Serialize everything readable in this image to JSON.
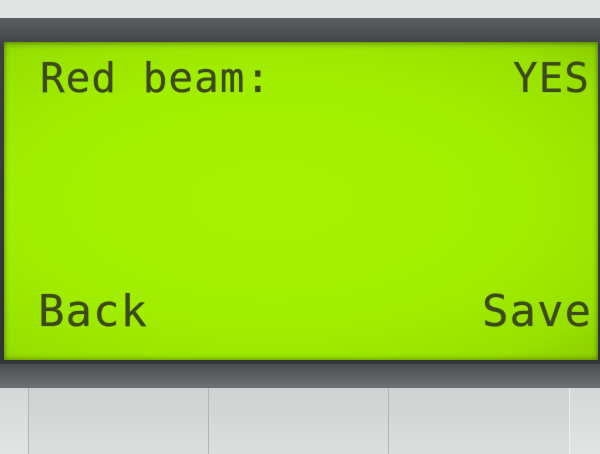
{
  "lcd": {
    "setting_label": "Red beam:",
    "setting_value": "YES",
    "softkey_left": "Back",
    "softkey_right": "Save"
  },
  "colors": {
    "lcd_background": "#a2ee00",
    "lcd_text": "#3d4a1c",
    "bezel": "#2f3335"
  }
}
